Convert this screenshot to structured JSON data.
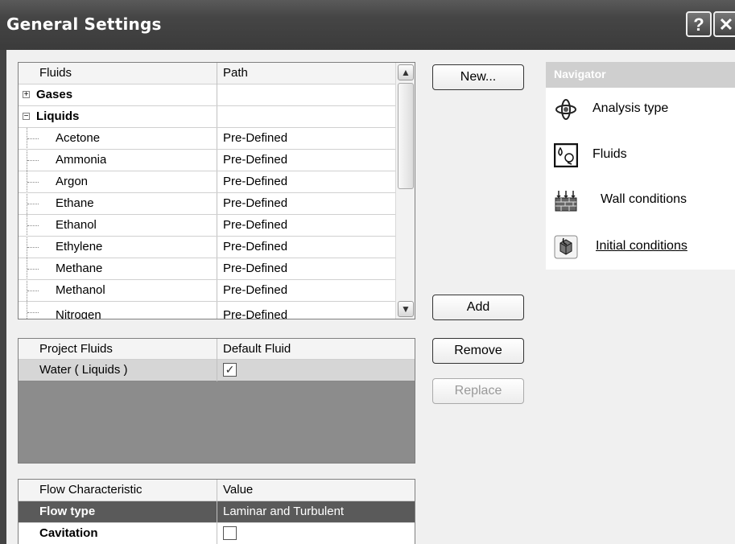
{
  "window": {
    "title": "General Settings",
    "help_label": "?",
    "close_label": "✕"
  },
  "fluids_table": {
    "col_fluids": "Fluids",
    "col_path": "Path",
    "groups": [
      {
        "name": "Gases",
        "toggle": "+"
      },
      {
        "name": "Liquids",
        "toggle": "−"
      }
    ],
    "items": [
      {
        "name": "Acetone",
        "path": "Pre-Defined"
      },
      {
        "name": "Ammonia",
        "path": "Pre-Defined"
      },
      {
        "name": "Argon",
        "path": "Pre-Defined"
      },
      {
        "name": "Ethane",
        "path": "Pre-Defined"
      },
      {
        "name": "Ethanol",
        "path": "Pre-Defined"
      },
      {
        "name": "Ethylene",
        "path": "Pre-Defined"
      },
      {
        "name": "Methane",
        "path": "Pre-Defined"
      },
      {
        "name": "Methanol",
        "path": "Pre-Defined"
      },
      {
        "name": "Nitrogen",
        "path": "Pre-Defined"
      }
    ]
  },
  "project_table": {
    "col_fluids": "Project Fluids",
    "col_default": "Default Fluid",
    "rows": [
      {
        "name": "Water ( Liquids )",
        "default_checked": true
      }
    ]
  },
  "flow_table": {
    "col_char": "Flow Characteristic",
    "col_value": "Value",
    "rows": [
      {
        "name": "Flow type",
        "value": "Laminar and Turbulent",
        "selected": true
      },
      {
        "name": "Cavitation",
        "checkbox": true,
        "checked": false
      }
    ]
  },
  "buttons": {
    "new": "New...",
    "add": "Add",
    "remove": "Remove",
    "replace": "Replace"
  },
  "navigator": {
    "title": "Navigator",
    "items": [
      {
        "label": "Analysis type",
        "icon": "analysis-type-icon"
      },
      {
        "label": "Fluids",
        "icon": "fluids-icon"
      },
      {
        "label": "Wall conditions",
        "icon": "wall-conditions-icon"
      },
      {
        "label": "Initial conditions",
        "icon": "initial-conditions-icon"
      }
    ]
  },
  "colors": {
    "titlebar": "#3b3b3b",
    "selected_row": "#5a5a5a",
    "project_empty": "#8c8c8c",
    "navigator_header": "#cfcfcf"
  }
}
